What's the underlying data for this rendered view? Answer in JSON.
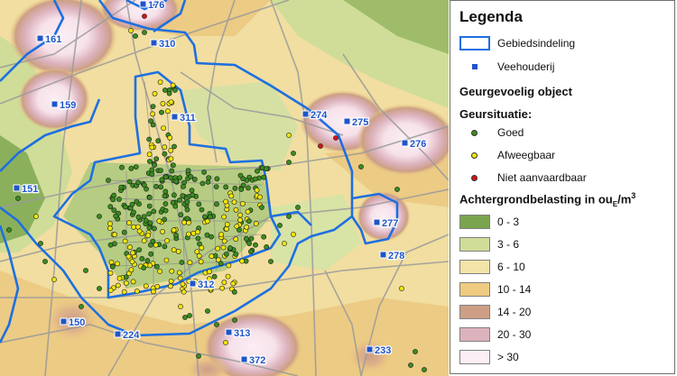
{
  "legend": {
    "title": "Legenda",
    "boundary_label": "Gebiedsindeling",
    "farm_label": "Veehouderij",
    "sensitive_label": "Geurgevoelig object",
    "situation_title": "Geursituatie:",
    "situations": [
      {
        "label": "Goed",
        "color": "#3a8c1f"
      },
      {
        "label": "Afweegbaar",
        "color": "#f2e60c"
      },
      {
        "label": "Niet aanvaardbaar",
        "color": "#d51414"
      }
    ],
    "background_title": "Achtergrondbelasting in ou",
    "background_title_sub": "E",
    "background_title_unit": "/m",
    "background_title_sup": "3",
    "classes": [
      {
        "label": "0 - 3",
        "color": "#7aa54e"
      },
      {
        "label": "3 - 6",
        "color": "#cfdd98"
      },
      {
        "label": "6 - 10",
        "color": "#f3e4a8"
      },
      {
        "label": "10 - 14",
        "color": "#eecb80"
      },
      {
        "label": "14 - 20",
        "color": "#cc9f86"
      },
      {
        "label": "20 - 30",
        "color": "#dcb2bd"
      },
      {
        "label": "> 30",
        "color": "#fbeef4"
      }
    ]
  },
  "map": {
    "boundary_color": "#1e6fe0",
    "farm_color": "#1f55c8",
    "farms": [
      "176",
      "161",
      "310",
      "159",
      "311",
      "274",
      "275",
      "276",
      "151",
      "277",
      "278",
      "312",
      "150",
      "224",
      "313",
      "372",
      "233"
    ]
  }
}
